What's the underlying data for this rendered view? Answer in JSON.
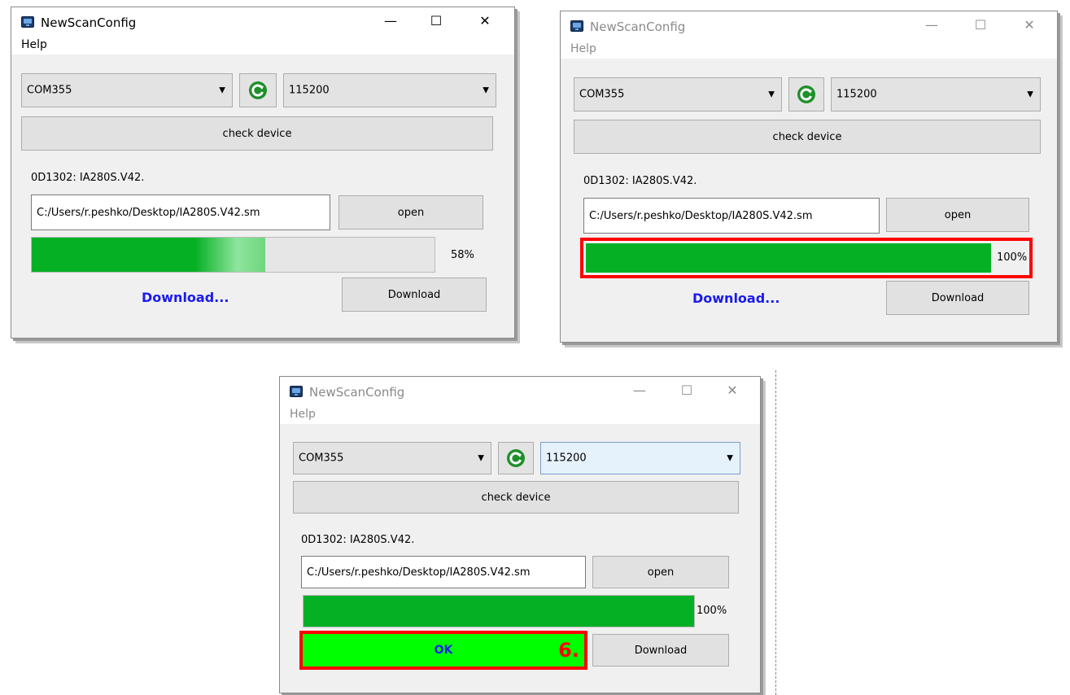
{
  "windows": [
    {
      "title": "NewScanConfig",
      "menu_help": "Help",
      "com_port": "COM355",
      "baud_rate": "115200",
      "check_device_label": "check device",
      "device_info": "0D1302: IA280S.V42.",
      "file_path": "C:/Users/r.peshko/Desktop/IA280S.V42.sm",
      "open_label": "open",
      "progress_percent_text": "58%",
      "progress_fraction": 0.58,
      "status_text": "Download...",
      "download_label": "Download"
    },
    {
      "title": "NewScanConfig",
      "menu_help": "Help",
      "com_port": "COM355",
      "baud_rate": "115200",
      "check_device_label": "check device",
      "device_info": "0D1302: IA280S.V42.",
      "file_path": "C:/Users/r.peshko/Desktop/IA280S.V42.sm",
      "open_label": "open",
      "progress_percent_text": "100%",
      "progress_fraction": 1.0,
      "status_text": "Download...",
      "download_label": "Download"
    },
    {
      "title": "NewScanConfig",
      "menu_help": "Help",
      "com_port": "COM355",
      "baud_rate": "115200",
      "check_device_label": "check device",
      "device_info": "0D1302: IA280S.V42.",
      "file_path": "C:/Users/r.peshko/Desktop/IA280S.V42.sm",
      "open_label": "open",
      "progress_percent_text": "100%",
      "progress_fraction": 1.0,
      "ok_label": "OK",
      "step_number": "6.",
      "download_label": "Download"
    }
  ],
  "caption_buttons": {
    "minimize": "—",
    "maximize": "☐",
    "close": "✕"
  },
  "icons": [
    "app-icon",
    "refresh-icon",
    "chevron-down-icon"
  ],
  "colors": {
    "progress_green": "#06b025",
    "ok_green": "#00ff00",
    "highlight_red": "#ff0000",
    "status_blue": "#1a1aee"
  }
}
